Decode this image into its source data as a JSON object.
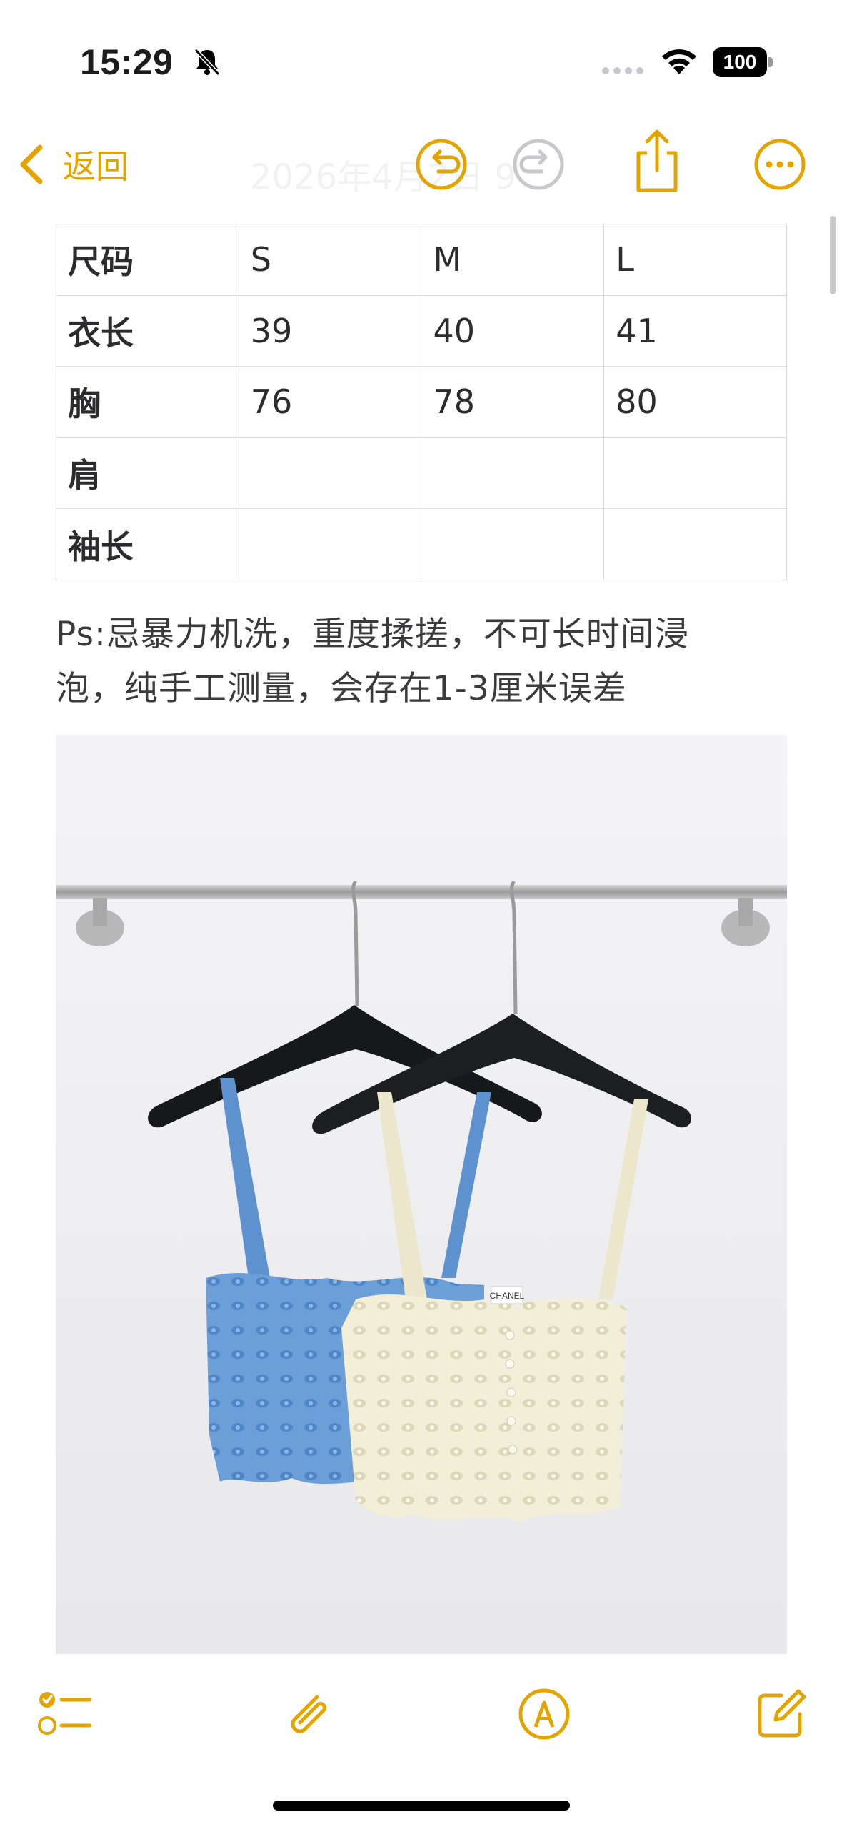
{
  "status_bar": {
    "time": "15:29",
    "battery": "100",
    "icons": [
      "bell-slash-icon",
      "cellular-dots-icon",
      "wifi-icon",
      "battery-icon"
    ]
  },
  "nav": {
    "back_label": "返回",
    "faded_title": "2026年4月2日 9",
    "icons": [
      "chevron-left-icon",
      "undo-icon",
      "redo-icon",
      "share-icon",
      "more-icon"
    ]
  },
  "size_table": {
    "rows": [
      [
        "尺码",
        "S",
        "M",
        "L"
      ],
      [
        "衣长",
        "39",
        "40",
        "41"
      ],
      [
        "胸",
        "76",
        "78",
        "80"
      ],
      [
        "肩",
        "",
        "",
        ""
      ],
      [
        "袖长",
        "",
        "",
        ""
      ]
    ]
  },
  "note": {
    "line1": "Ps:忌暴力机洗，重度揉搓，不可长时间浸",
    "line2": "泡，纯手工测量，会存在1-3厘米误差"
  },
  "photo": {
    "label_text": "CHANEL"
  },
  "toolbar": {
    "icons": [
      "checklist-icon",
      "paperclip-icon",
      "markup-icon",
      "compose-icon"
    ]
  },
  "colors": {
    "accent": "#e3a400",
    "blue_top": "#6c9fd8",
    "cream_top": "#f2eed8"
  }
}
